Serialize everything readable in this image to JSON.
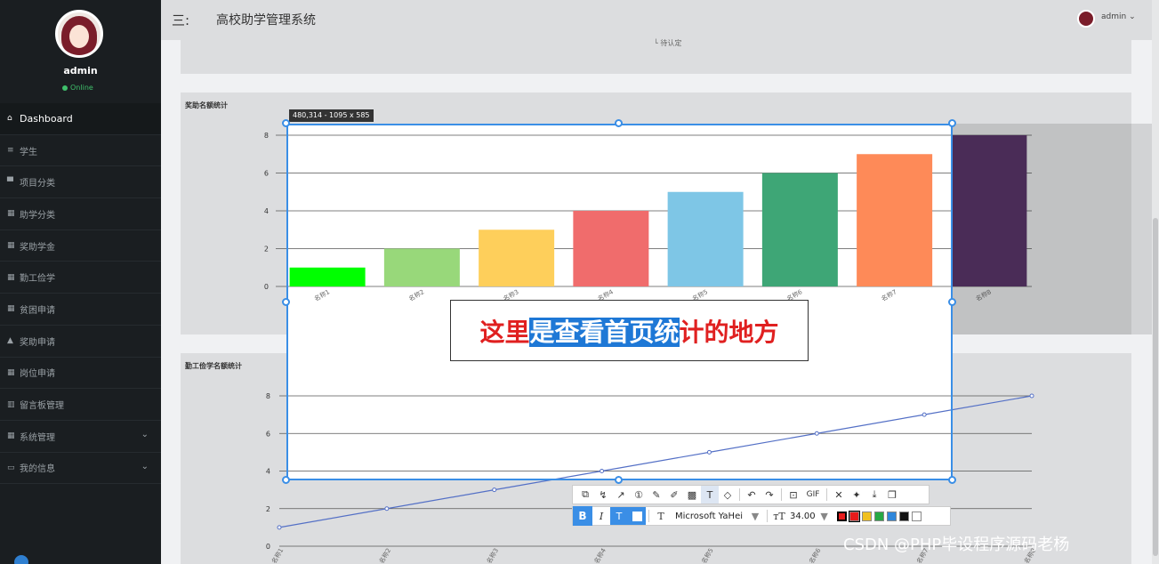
{
  "user": {
    "name": "admin",
    "status": "Online"
  },
  "nav": [
    {
      "label": "Dashboard",
      "icon": "⌂",
      "active": true
    },
    {
      "label": "学生",
      "icon": "≡"
    },
    {
      "label": "项目分类",
      "icon": "▀"
    },
    {
      "label": "助学分类",
      "icon": "▦"
    },
    {
      "label": "奖助学金",
      "icon": "▦"
    },
    {
      "label": "勤工俭学",
      "icon": "▦"
    },
    {
      "label": "贫困申请",
      "icon": "▦"
    },
    {
      "label": "奖助申请",
      "icon": "▲"
    },
    {
      "label": "岗位申请",
      "icon": "▦"
    },
    {
      "label": "留言板管理",
      "icon": "▥"
    },
    {
      "label": "系统管理",
      "icon": "▦",
      "chevron": true
    },
    {
      "label": "我的信息",
      "icon": "▭",
      "chevron": true
    }
  ],
  "header": {
    "title": "高校助学管理系统",
    "menu_icon": "三:",
    "user": "admin"
  },
  "top_card": {
    "pending": "待认定"
  },
  "chart1_title": "奖助名额统计",
  "chart2_title": "勤工俭学名额统计",
  "screenshot": {
    "dim_label": "480,314 - 1095 x 585",
    "annotation_parts": [
      "这里",
      "是查看首页统",
      "计的地方"
    ]
  },
  "toolbar": {
    "icons": [
      "shape-icon",
      "polyline-icon",
      "arrow-icon",
      "number-icon",
      "pen-icon",
      "marker-icon",
      "mosaic-icon",
      "text-icon",
      "eraser-icon",
      "undo-icon",
      "redo-icon",
      "save-icon",
      "gif-icon",
      "close-icon",
      "pin-icon",
      "download-icon",
      "copy-icon"
    ],
    "gif_label": "GIF",
    "font_name": "Microsoft YaHei",
    "font_size": "34.00",
    "colors": [
      "#e81c1c",
      "#f0c020",
      "#27a844",
      "#2f87db",
      "#111111",
      "#ffffff"
    ],
    "selected_color": "#e81c1c"
  },
  "watermark": "CSDN @PHP毕设程序源码老杨",
  "chart_data": [
    {
      "type": "bar",
      "title": "奖助名额统计",
      "categories": [
        "名称1",
        "名称2",
        "名称3",
        "名称4",
        "名称5",
        "名称6",
        "名称7",
        "名称8"
      ],
      "values": [
        1,
        2,
        3,
        4,
        5,
        6,
        7,
        8
      ],
      "colors": [
        "#00ff00",
        "#98d87a",
        "#fecf5b",
        "#f06c6c",
        "#7ec6e6",
        "#3ea676",
        "#fe8a58",
        "#553364"
      ],
      "ylim": [
        0,
        8
      ],
      "yticks": [
        0,
        2,
        4,
        6,
        8
      ],
      "grid": true
    },
    {
      "type": "line",
      "title": "勤工俭学名额统计",
      "categories": [
        "名称1",
        "名称2",
        "名称3",
        "名称4",
        "名称5",
        "名称6",
        "名称7",
        "名称8"
      ],
      "values": [
        1,
        2,
        3,
        4,
        5,
        6,
        7,
        8
      ],
      "color": "#5470c6",
      "ylim": [
        0,
        8
      ],
      "yticks": [
        0,
        2,
        4,
        6,
        8
      ],
      "grid": true
    }
  ]
}
